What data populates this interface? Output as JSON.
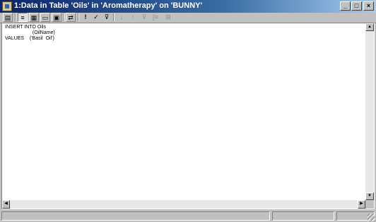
{
  "window": {
    "title": "1:Data in Table 'Oils' in 'Aromatherapy' on 'BUNNY'",
    "minimize_glyph": "_",
    "maximize_glyph": "□",
    "close_glyph": "×"
  },
  "toolbar": {
    "icons": [
      "properties-icon",
      "sql-pane-icon",
      "grid-pane-icon",
      "diagram-pane-icon",
      "results-pane-icon",
      "change-type-icon",
      "run-icon",
      "verify-sql-icon",
      "remove-filter-icon",
      "sort-ascending-icon",
      "sort-descending-icon",
      "remove-filter-icon-2",
      "group-by-icon",
      "add-table-icon"
    ]
  },
  "editor": {
    "sql_text": "INSERT INTO Oils\n                    (OilName)\nVALUES    ('Basil  Oil')"
  },
  "statusbar": {
    "panels": [
      "",
      "",
      ""
    ]
  }
}
